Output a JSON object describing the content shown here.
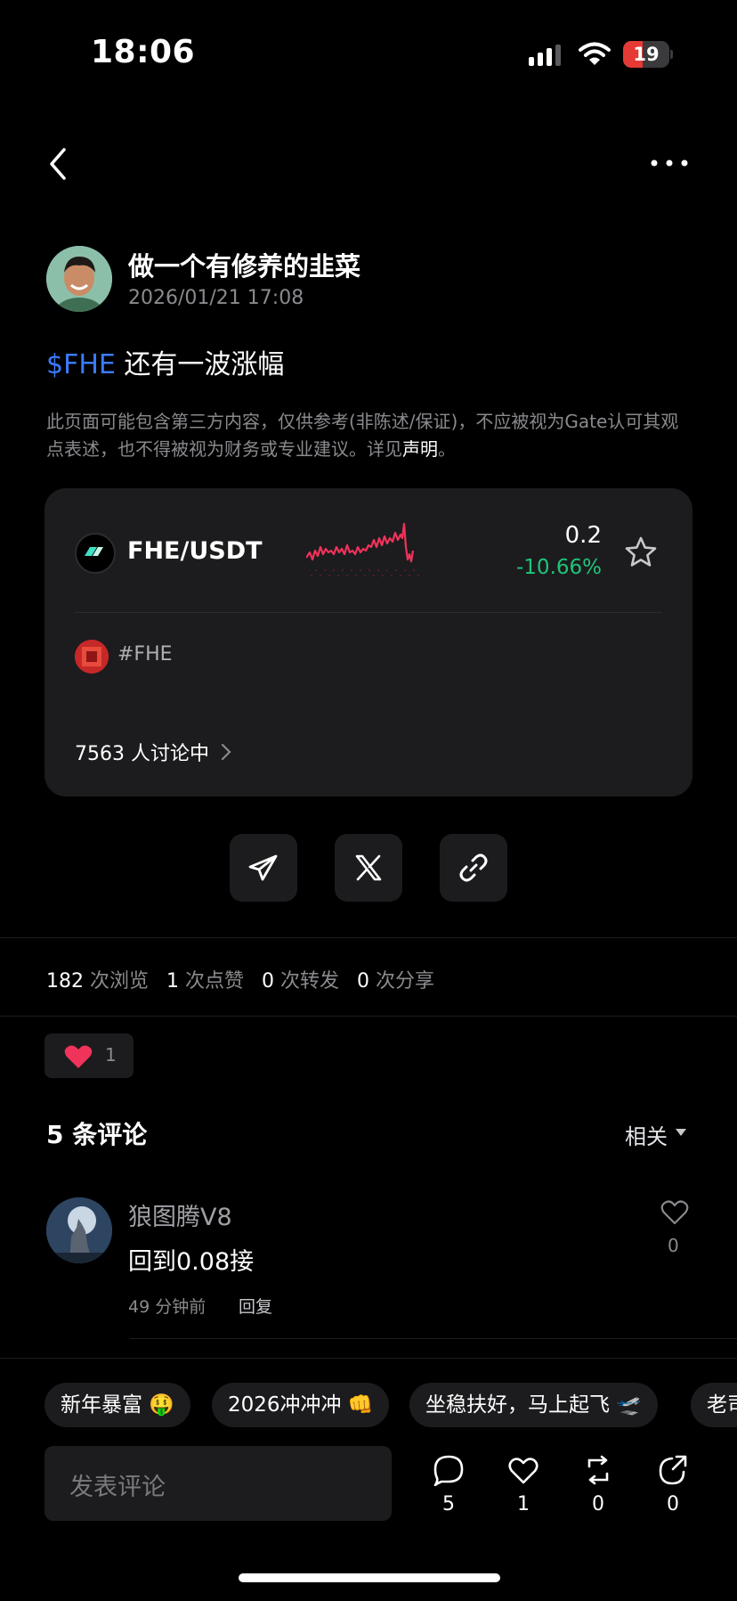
{
  "status_bar": {
    "time": "18:06",
    "battery": "19",
    "battery_level": 0.19
  },
  "post": {
    "author": "做一个有修养的韭菜",
    "date": "2026/01/21 17:08",
    "ticker": "$FHE",
    "title_text": " 还有一波涨幅",
    "disclaimer_pre": "此页面可能包含第三方内容，仅供参考(非陈述/保证)，不应被视为Gate认可其观点表述，也不得被视为财务或专业建议。详见",
    "disclaimer_link": "声明",
    "disclaimer_end": "。"
  },
  "market_card": {
    "pair": "FHE/USDT",
    "price": "0.2",
    "change": "-10.66%",
    "tag": "#FHE",
    "discussion": "7563 人讨论中",
    "colors": {
      "up": "#1fc47a",
      "sparkline": "#f0335a"
    }
  },
  "stats": {
    "views": "182",
    "views_label": "次浏览",
    "likes": "1",
    "likes_label": "次点赞",
    "reposts": "0",
    "reposts_label": "次转发",
    "shares": "0",
    "shares_label": "次分享"
  },
  "reactions": {
    "heart_count": "1"
  },
  "comments": {
    "title": "5 条评论",
    "sort": "相关",
    "items": [
      {
        "user": "狼图腾V8",
        "text": "回到0.08接",
        "time": "49 分钟前",
        "reply": "回复",
        "likes": "0"
      }
    ]
  },
  "quick_replies": [
    "新年暴富 🤑",
    "2026冲冲冲 👊",
    "坐稳扶好，马上起飞 🛫",
    "老司"
  ],
  "bottom_bar": {
    "input_placeholder": "发表评论",
    "comments": "5",
    "likes": "1",
    "reposts": "0",
    "shares": "0"
  }
}
